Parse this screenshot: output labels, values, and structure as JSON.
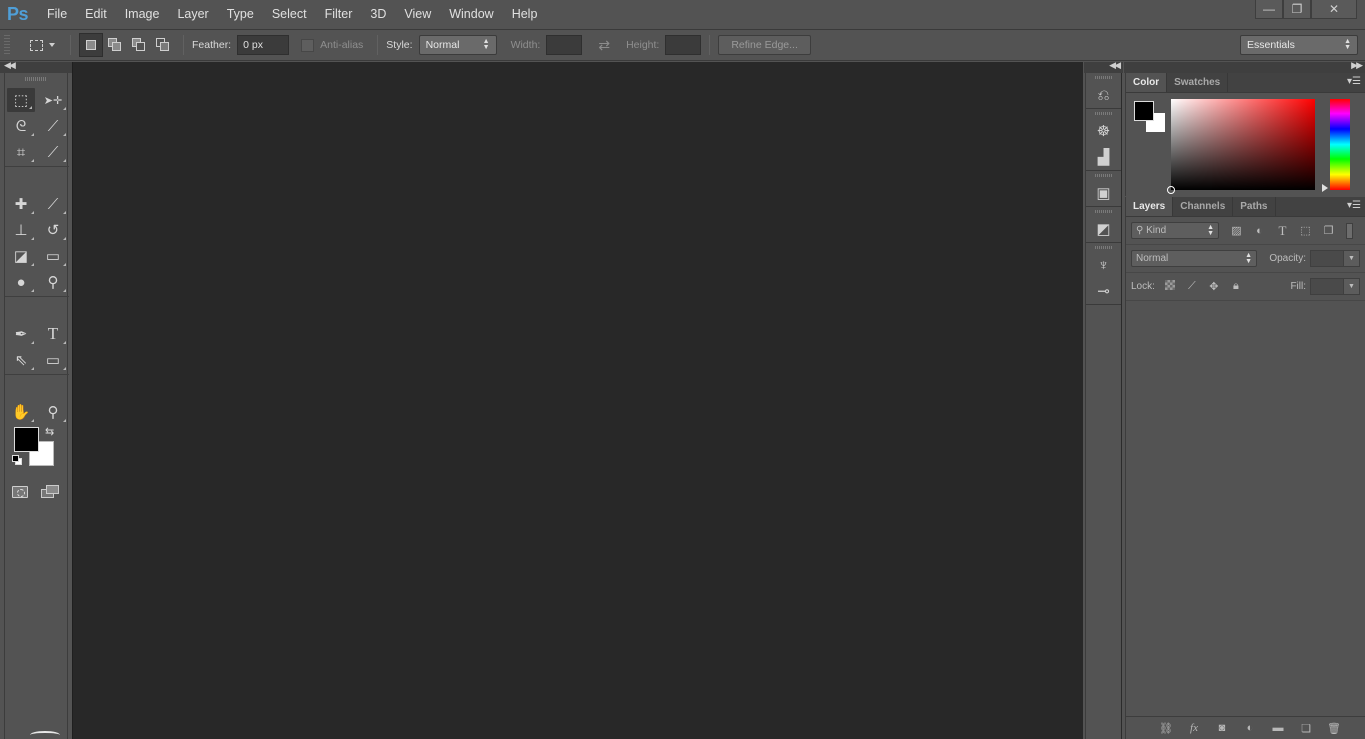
{
  "app": {
    "logo": "Ps",
    "name": "Adobe Photoshop"
  },
  "menubar": {
    "items": [
      "File",
      "Edit",
      "Image",
      "Layer",
      "Type",
      "Select",
      "Filter",
      "3D",
      "View",
      "Window",
      "Help"
    ]
  },
  "window_controls": {
    "minimize": "—",
    "restore": "❐",
    "close": "✕"
  },
  "options": {
    "feather_label": "Feather:",
    "feather_value": "0 px",
    "antialias_label": "Anti-alias",
    "antialias_checked": false,
    "style_label": "Style:",
    "style_value": "Normal",
    "width_label": "Width:",
    "width_value": "",
    "height_label": "Height:",
    "height_value": "",
    "refine_edge_label": "Refine Edge...",
    "workspace_value": "Essentials",
    "selection_modes": [
      "new-selection",
      "add-to-selection",
      "subtract-from-selection",
      "intersect-with-selection"
    ],
    "active_selection_mode": "new-selection"
  },
  "toolbox": {
    "tools": [
      {
        "name": "rectangular-marquee",
        "glyph": "⬚",
        "active": true
      },
      {
        "name": "move",
        "glyph": "➤✛",
        "active": false
      },
      {
        "name": "lasso",
        "glyph": "ᘓ",
        "active": false
      },
      {
        "name": "quick-selection",
        "glyph": "⟋",
        "active": false
      },
      {
        "name": "crop",
        "glyph": "⌗",
        "active": false
      },
      {
        "name": "eyedropper",
        "glyph": "⟋",
        "active": false
      },
      {
        "name": "spot-healing-brush",
        "glyph": "✚",
        "active": false
      },
      {
        "name": "brush",
        "glyph": "⟋",
        "active": false
      },
      {
        "name": "clone-stamp",
        "glyph": "⊥",
        "active": false
      },
      {
        "name": "history-brush",
        "glyph": "↺",
        "active": false
      },
      {
        "name": "eraser",
        "glyph": "◪",
        "active": false
      },
      {
        "name": "gradient",
        "glyph": "▭",
        "active": false
      },
      {
        "name": "blur",
        "glyph": "●",
        "active": false
      },
      {
        "name": "dodge",
        "glyph": "⚲",
        "active": false
      },
      {
        "name": "pen",
        "glyph": "✒",
        "active": false
      },
      {
        "name": "type",
        "glyph": "T",
        "active": false
      },
      {
        "name": "path-selection",
        "glyph": "⇖",
        "active": false
      },
      {
        "name": "rectangle",
        "glyph": "▭",
        "active": false
      },
      {
        "name": "hand",
        "glyph": "✋",
        "active": false
      },
      {
        "name": "zoom",
        "glyph": "⚲",
        "active": false
      }
    ],
    "foreground_color": "#000000",
    "background_color": "#ffffff"
  },
  "dock": {
    "groups": [
      [
        {
          "name": "history",
          "glyph": "⎌"
        }
      ],
      [
        {
          "name": "navigator",
          "glyph": "☸"
        },
        {
          "name": "histogram",
          "glyph": "▟"
        }
      ],
      [
        {
          "name": "properties",
          "glyph": "▣"
        }
      ],
      [
        {
          "name": "paths-panel",
          "glyph": "◩"
        }
      ],
      [
        {
          "name": "brush-presets",
          "glyph": "♆"
        },
        {
          "name": "brush-settings",
          "glyph": "⊸"
        }
      ]
    ]
  },
  "color_panel": {
    "tabs": [
      {
        "label": "Color",
        "active": true
      },
      {
        "label": "Swatches",
        "active": false
      }
    ],
    "foreground": "#000000",
    "background": "#ffffff",
    "hue": "#ff0000"
  },
  "layers_panel": {
    "tabs": [
      {
        "label": "Layers",
        "active": true
      },
      {
        "label": "Channels",
        "active": false
      },
      {
        "label": "Paths",
        "active": false
      }
    ],
    "kind_label": "Kind",
    "filter_icons": [
      "pixel-filter",
      "adjustment-filter",
      "type-filter",
      "shape-filter",
      "smart-object-filter"
    ],
    "blend_mode": "Normal",
    "opacity_label": "Opacity:",
    "opacity_value": "",
    "lock_label": "Lock:",
    "lock_icons": [
      "lock-transparent-pixels",
      "lock-image-pixels",
      "lock-position",
      "lock-all"
    ],
    "fill_label": "Fill:",
    "fill_value": "",
    "layers": [],
    "footer_icons": [
      "link-layers",
      "add-layer-style",
      "add-layer-mask",
      "new-adjustment-layer",
      "new-group",
      "new-layer",
      "delete-layer"
    ]
  }
}
